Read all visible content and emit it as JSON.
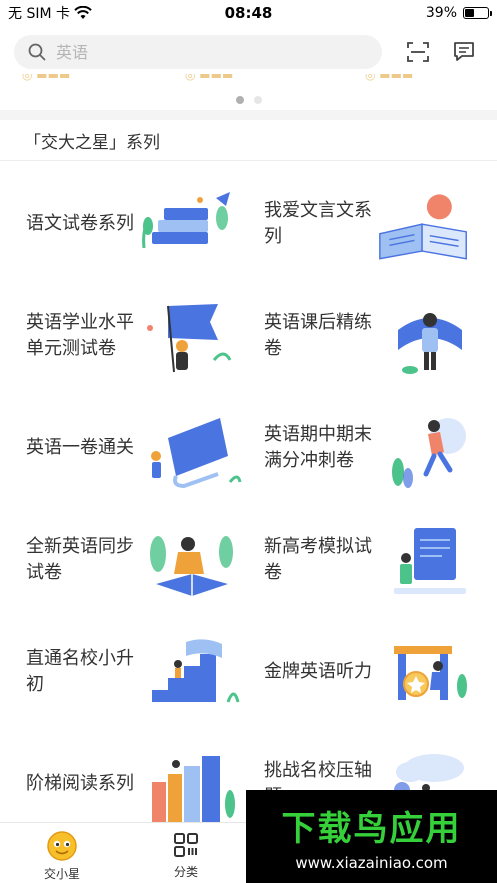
{
  "status": {
    "carrier": "无 SIM 卡",
    "time": "08:48",
    "battery": "39%",
    "battery_level": 0.39
  },
  "search": {
    "placeholder": "英语"
  },
  "carousel": {
    "pages": 2,
    "active_index": 0
  },
  "section": {
    "title": "「交大之星」系列"
  },
  "series": [
    {
      "label": "语文试卷系列",
      "art": "books-illustration"
    },
    {
      "label": "我爱文言文系列",
      "art": "open-book-illustration"
    },
    {
      "label": "英语学业水平单元测试卷",
      "art": "flag-illustration"
    },
    {
      "label": "英语课后精练卷",
      "art": "ribbon-person-illustration"
    },
    {
      "label": "英语一卷通关",
      "art": "scroll-illustration"
    },
    {
      "label": "英语期中期末满分冲刺卷",
      "art": "running-person-illustration"
    },
    {
      "label": "全新英语同步试卷",
      "art": "reading-person-illustration"
    },
    {
      "label": "新高考模拟试卷",
      "art": "exam-board-illustration"
    },
    {
      "label": "直通名校小升初",
      "art": "stairs-illustration"
    },
    {
      "label": "金牌英语听力",
      "art": "medal-illustration"
    },
    {
      "label": "阶梯阅读系列",
      "art": "colored-books-illustration"
    },
    {
      "label": "挑战名校压轴题",
      "art": "cloud-tree-illustration"
    }
  ],
  "tabs": [
    {
      "label": "交小星",
      "icon": "mascot-icon",
      "active": true
    },
    {
      "label": "分类",
      "icon": "category-grid-icon",
      "active": false
    }
  ],
  "watermark": {
    "title": "下载鸟应用",
    "url": "www.xiazainiao.com"
  },
  "colors": {
    "accent_blue": "#4a74e0",
    "light_blue": "#9fc0f2",
    "leaf_green": "#4cc38a",
    "orange": "#f0a23a",
    "watermark_green": "#35d03a"
  }
}
